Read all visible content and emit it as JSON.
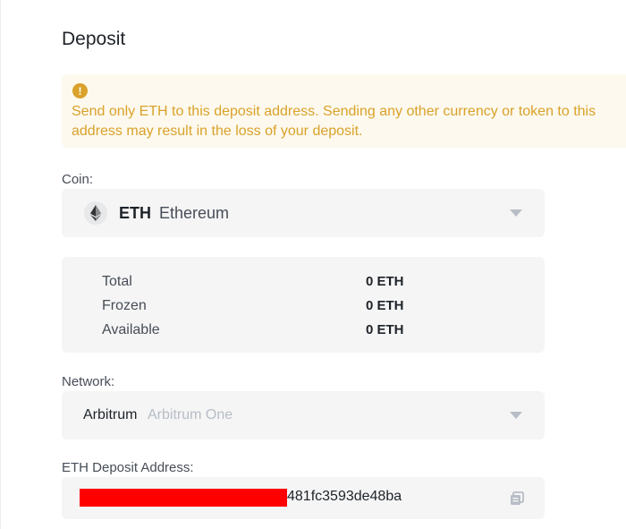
{
  "page": {
    "title": "Deposit"
  },
  "warning": {
    "icon": "exclamation-icon",
    "text": "Send only ETH to this deposit address. Sending any other currency or token to this address may result in the loss of your deposit.",
    "color": "#d9a22a"
  },
  "coin": {
    "label": "Coin:",
    "selected_symbol": "ETH",
    "selected_name": "Ethereum",
    "icon": "ethereum-icon"
  },
  "balances": [
    {
      "label": "Total",
      "value": "0 ETH"
    },
    {
      "label": "Frozen",
      "value": "0 ETH"
    },
    {
      "label": "Available",
      "value": "0 ETH"
    }
  ],
  "network": {
    "label": "Network:",
    "selected_primary": "Arbitrum",
    "selected_secondary": "Arbitrum One"
  },
  "address": {
    "label": "ETH Deposit Address:",
    "visible_suffix": "481fc3593de48ba",
    "redacted_color": "#ff0000",
    "copy_icon": "copy-icon"
  }
}
